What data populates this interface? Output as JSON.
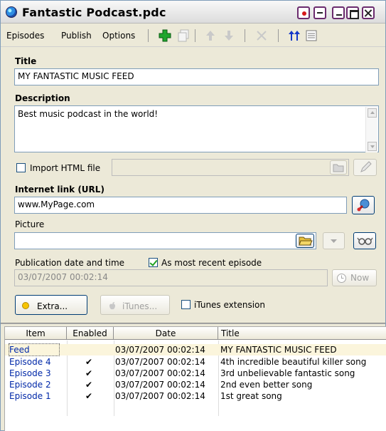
{
  "window": {
    "title": "Fantastic Podcast.pdc"
  },
  "menu": {
    "episodes": "Episodes",
    "publish": "Publish",
    "options": "Options"
  },
  "form": {
    "title_label": "Title",
    "title_value": "MY FANTASTIC MUSIC FEED",
    "description_label": "Description",
    "description_value": "Best music podcast in the world!",
    "import_label": "Import HTML file",
    "url_label": "Internet link (URL)",
    "url_value": "www.MyPage.com",
    "picture_label": "Picture",
    "pubdate_label": "Publication date and time",
    "recent_label": "As most recent episode",
    "pubdate_value": "03/07/2007 00:02:14",
    "now_label": "Now",
    "extra_label": "Extra...",
    "itunes_label": "iTunes...",
    "itunes_ext_label": "iTunes extension"
  },
  "grid": {
    "headers": {
      "item": "Item",
      "enabled": "Enabled",
      "date": "Date",
      "title": "Title"
    },
    "rows": [
      {
        "item": "Feed",
        "enabled": "",
        "date": "03/07/2007 00:02:14",
        "title": "MY FANTASTIC MUSIC FEED"
      },
      {
        "item": "Episode 4",
        "enabled": "✔",
        "date": "03/07/2007 00:02:14",
        "title": "4th incredible beautiful killer song"
      },
      {
        "item": "Episode 3",
        "enabled": "✔",
        "date": "03/07/2007 00:02:14",
        "title": "3rd unbelievable fantastic song"
      },
      {
        "item": "Episode 2",
        "enabled": "✔",
        "date": "03/07/2007 00:02:14",
        "title": "2nd even better song"
      },
      {
        "item": "Episode 1",
        "enabled": "✔",
        "date": "03/07/2007 00:02:14",
        "title": "1st great song"
      }
    ]
  },
  "icons": [
    "app-globe-icon",
    "record-icon",
    "dash-icon",
    "minimize-icon",
    "maximize-icon",
    "close-icon",
    "add-icon",
    "copy-icon",
    "arrow-up-icon",
    "arrow-down-icon",
    "delete-icon",
    "sort-icon",
    "list-icon",
    "folder-icon",
    "pencil-icon",
    "link-open-icon",
    "dropdown-icon",
    "glasses-icon",
    "clock-icon",
    "apple-icon"
  ]
}
